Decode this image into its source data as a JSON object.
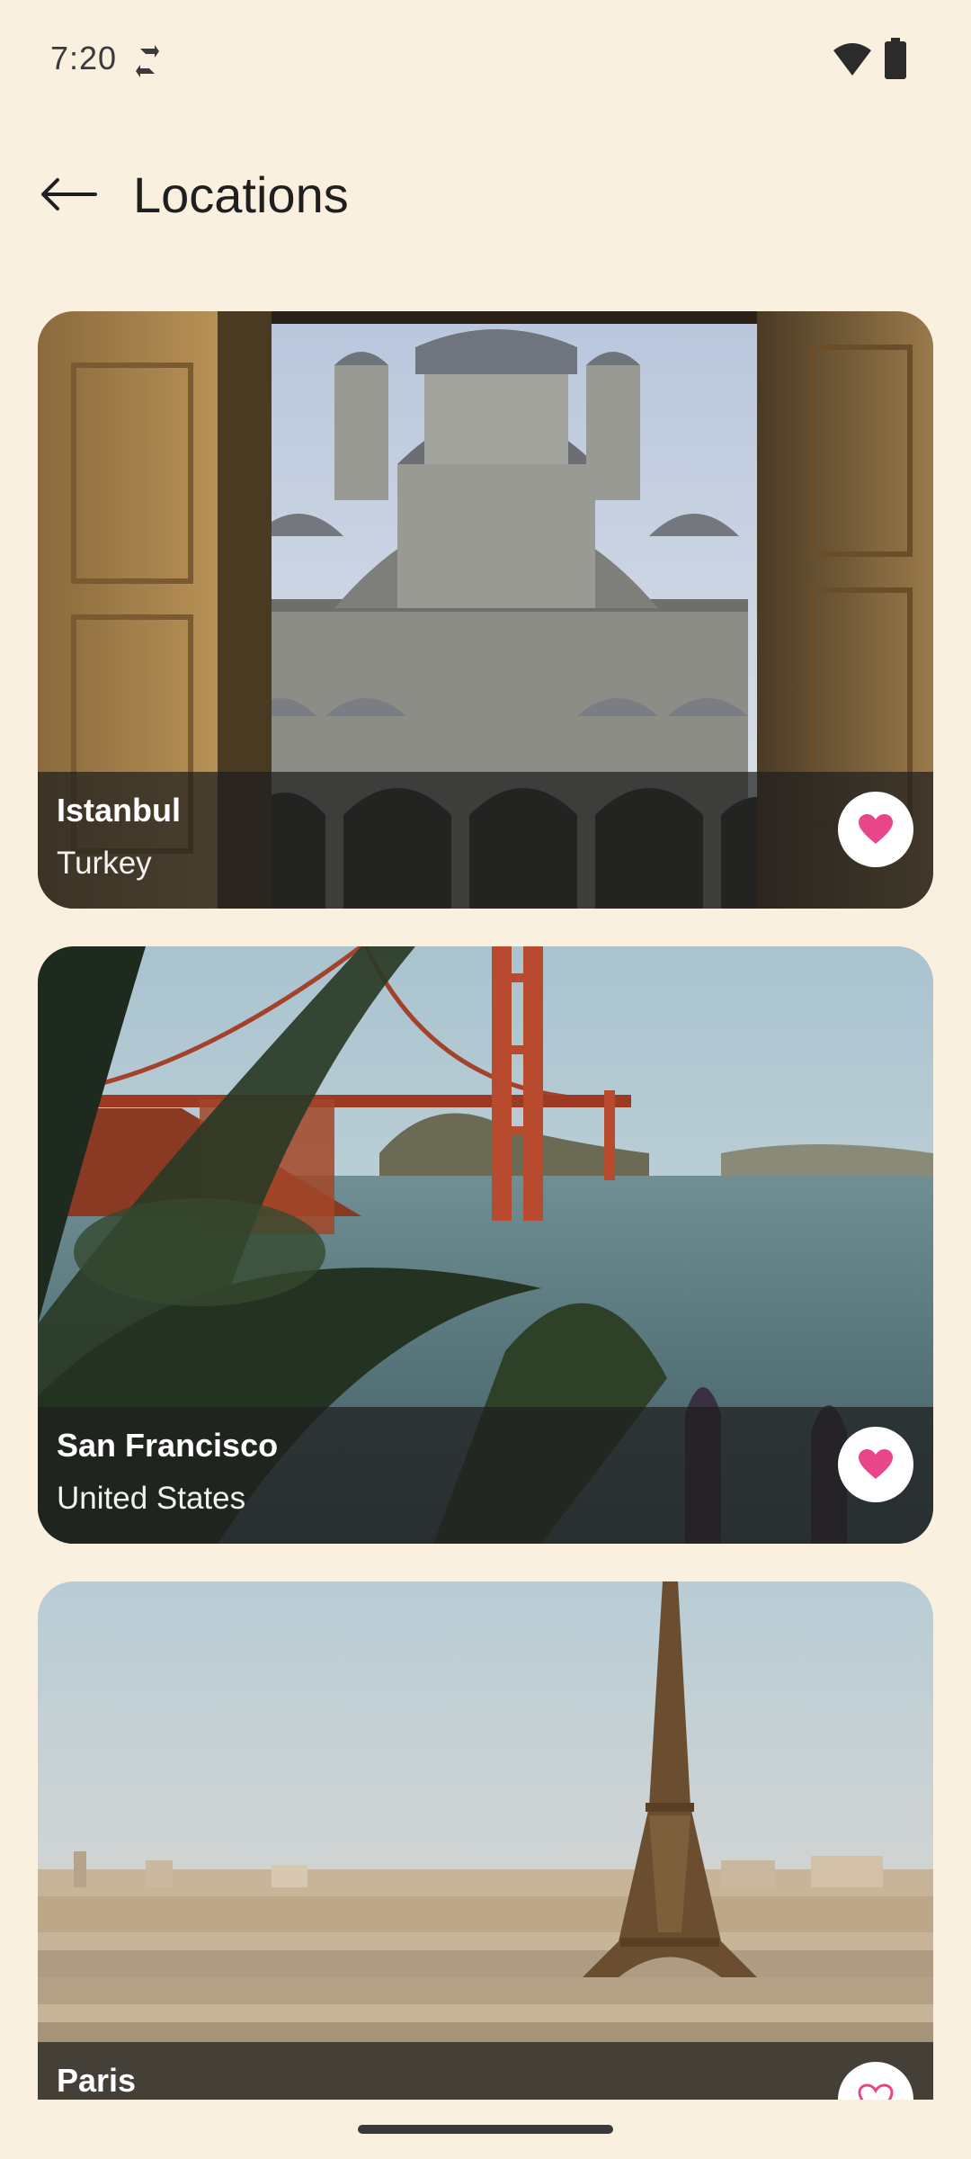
{
  "status_bar": {
    "time": "7:20",
    "icons": [
      "sync-icon",
      "wifi-icon",
      "battery-icon"
    ]
  },
  "app_bar": {
    "back_icon": "arrow-left-icon",
    "title": "Locations"
  },
  "colors": {
    "background": "#FAF0E0",
    "favorite_pink": "#E8458B",
    "overlay": "#1E1E1E"
  },
  "locations": [
    {
      "city": "Istanbul",
      "country": "Turkey",
      "favorited": true,
      "favorite_icon": "heart-filled-icon"
    },
    {
      "city": "San Francisco",
      "country": "United States",
      "favorited": true,
      "favorite_icon": "heart-filled-icon"
    },
    {
      "city": "Paris",
      "country": "",
      "favorited": false,
      "favorite_icon": "heart-outline-icon"
    }
  ]
}
